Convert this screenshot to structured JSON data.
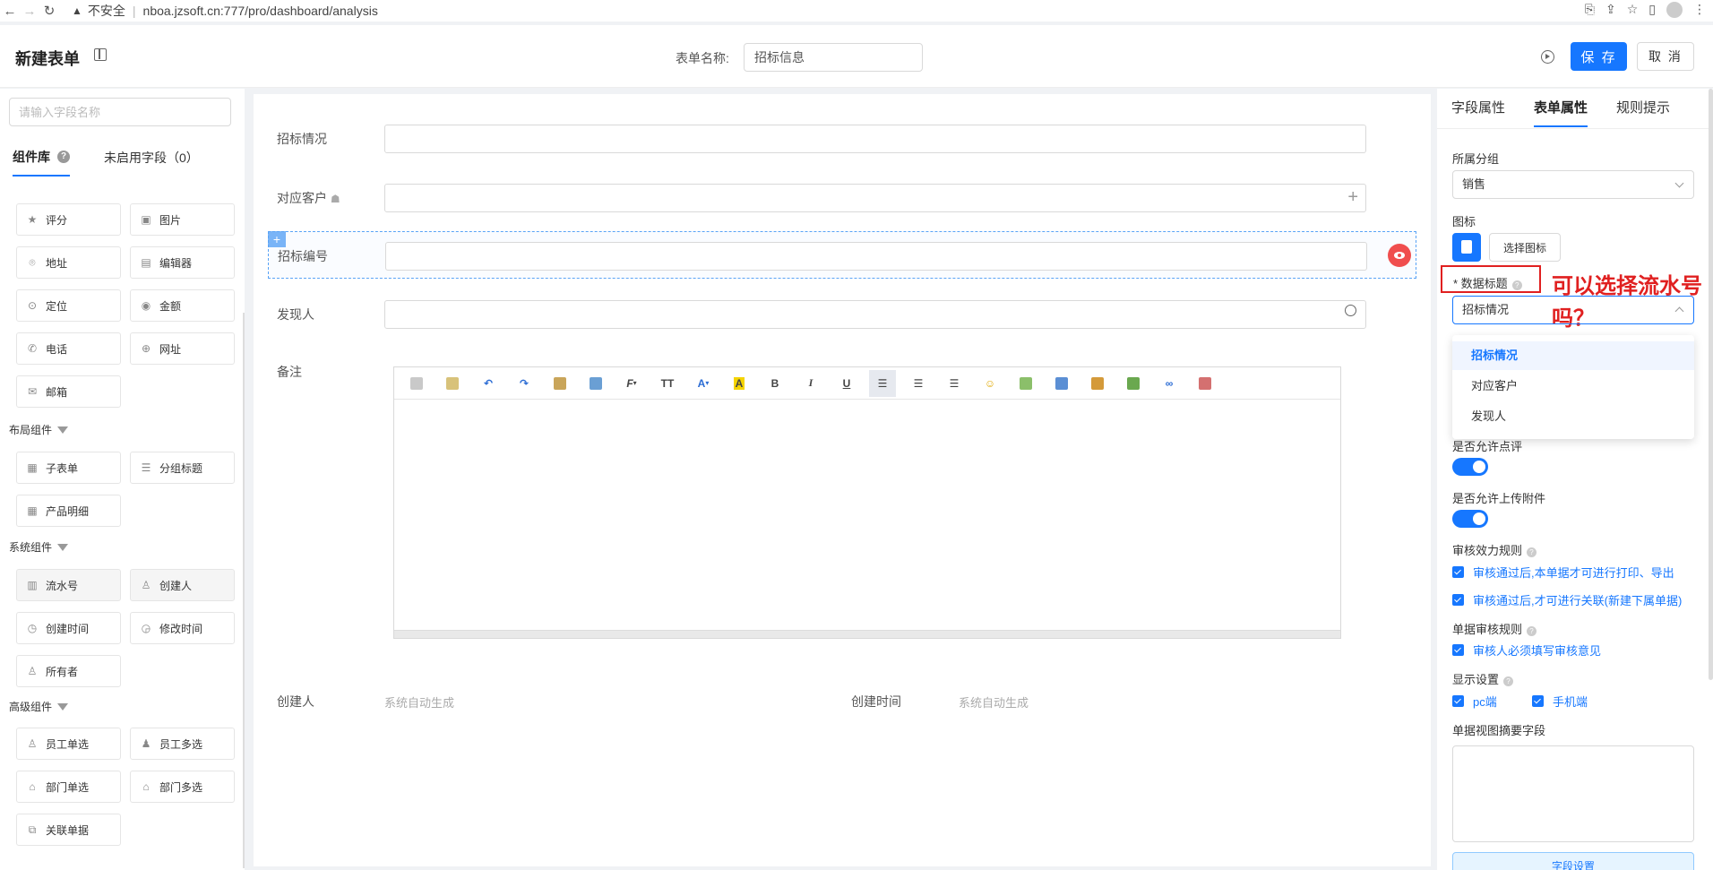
{
  "browser": {
    "security_label": "不安全",
    "url": "nboa.jzsoft.cn:777/pro/dashboard/analysis"
  },
  "header": {
    "title": "新建表单",
    "form_name_label": "表单名称:",
    "form_name_value": "招标信息",
    "save_label": "保 存",
    "cancel_label": "取 消"
  },
  "left_panel": {
    "search_placeholder": "请输入字段名称",
    "tabs": [
      {
        "label": "组件库"
      },
      {
        "label": "未启用字段（0）"
      }
    ],
    "basic_items": [
      {
        "label": "评分",
        "icon": "star-icon"
      },
      {
        "label": "图片",
        "icon": "image-icon"
      },
      {
        "label": "地址",
        "icon": "location-pin-icon"
      },
      {
        "label": "编辑器",
        "icon": "editor-icon"
      },
      {
        "label": "定位",
        "icon": "locate-icon"
      },
      {
        "label": "金额",
        "icon": "money-icon"
      },
      {
        "label": "电话",
        "icon": "phone-icon"
      },
      {
        "label": "网址",
        "icon": "globe-icon"
      },
      {
        "label": "邮箱",
        "icon": "mail-icon"
      }
    ],
    "layout_section": "布局组件",
    "layout_items": [
      {
        "label": "子表单",
        "icon": "table-icon"
      },
      {
        "label": "分组标题",
        "icon": "lines-icon"
      },
      {
        "label": "产品明细",
        "icon": "table-icon"
      }
    ],
    "system_section": "系统组件",
    "system_items": [
      {
        "label": "流水号",
        "icon": "serial-icon"
      },
      {
        "label": "创建人",
        "icon": "user-icon"
      },
      {
        "label": "创建时间",
        "icon": "clock-icon"
      },
      {
        "label": "修改时间",
        "icon": "edit-clock-icon"
      },
      {
        "label": "所有者",
        "icon": "user-icon"
      }
    ],
    "advanced_section": "高级组件",
    "advanced_items": [
      {
        "label": "员工单选",
        "icon": "user-single-icon"
      },
      {
        "label": "员工多选",
        "icon": "users-icon"
      },
      {
        "label": "部门单选",
        "icon": "department-icon"
      },
      {
        "label": "部门多选",
        "icon": "department-icon"
      },
      {
        "label": "关联单据",
        "icon": "link-doc-icon"
      }
    ]
  },
  "canvas": {
    "fields": [
      {
        "label": "招标情况"
      },
      {
        "label": "对应客户"
      },
      {
        "label": "招标编号"
      },
      {
        "label": "发现人"
      },
      {
        "label": "备注"
      }
    ],
    "creator_label": "创建人",
    "creator_value": "系统自动生成",
    "created_time_label": "创建时间",
    "created_time_value": "系统自动生成"
  },
  "right_panel": {
    "tabs": [
      {
        "label": "字段属性"
      },
      {
        "label": "表单属性"
      },
      {
        "label": "规则提示"
      }
    ],
    "group_label": "所属分组",
    "group_value": "销售",
    "icon_label": "图标",
    "choose_icon_label": "选择图标",
    "data_title_label": "* 数据标题",
    "data_title_value": "招标情况",
    "annotation": "可以选择流水号吗？",
    "dropdown_options": [
      {
        "label": "招标情况"
      },
      {
        "label": "对应客户"
      },
      {
        "label": "发现人"
      }
    ],
    "allow_comment_label": "是否允许点评",
    "allow_upload_label": "是否允许上传附件",
    "audit_effect_label": "审核效力规则",
    "audit_effect_options": [
      {
        "label": "审核通过后,本单据才可进行打印、导出"
      },
      {
        "label": "审核通过后,才可进行关联(新建下属单据)"
      }
    ],
    "audit_rule_label": "单据审核规则",
    "audit_rule_option": "审核人必须填写审核意见",
    "display_label": "显示设置",
    "display_pc": "pc端",
    "display_mobile": "手机端",
    "summary_label": "单据视图摘要字段",
    "field_settings_label": "字段设置"
  },
  "colors": {
    "accent": "#1677ff",
    "annotation_red": "#e02020"
  }
}
